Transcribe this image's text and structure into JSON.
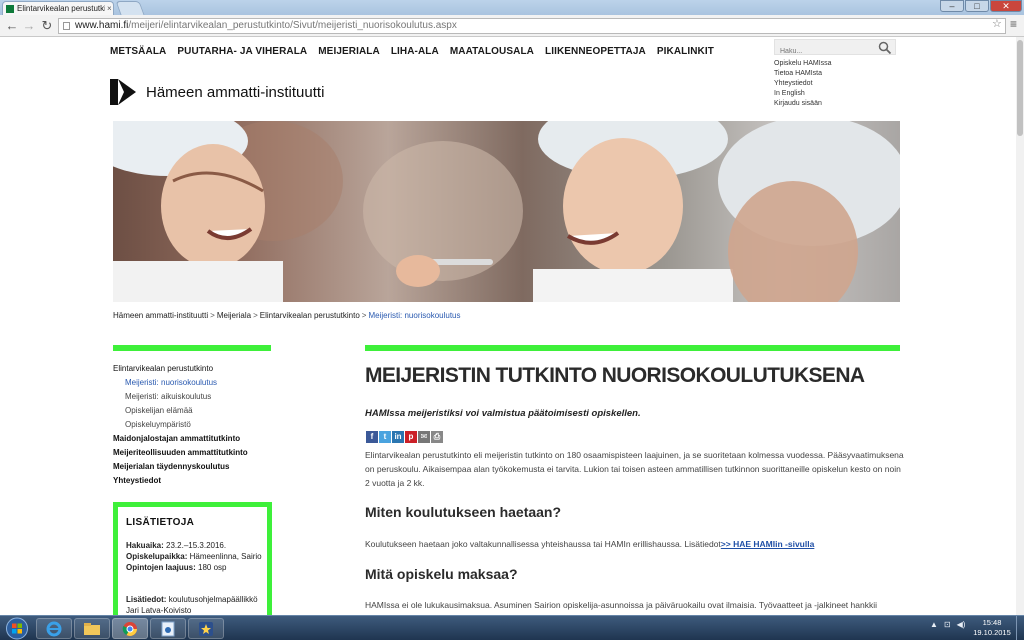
{
  "browser": {
    "tab_title": "Elintarvikealan perustutkinto",
    "tab_close": "×",
    "url_host": "www.hami.fi",
    "url_path": "/meijeri/elintarvikealan_perustutkinto/Sivut/meijeristi_nuorisokoulutus.aspx",
    "window_controls": {
      "minimize": "‒",
      "maximize": "□",
      "close": "✕"
    }
  },
  "site": {
    "topnav": [
      "METSÄALA",
      "PUUTARHA- JA VIHERALA",
      "MEIJERIALA",
      "LIHA-ALA",
      "MAATALOUSALA",
      "LIIKENNEOPETTAJA",
      "PIKALINKIT"
    ],
    "search_placeholder": "Haku...",
    "utility_links": [
      "Opiskelu HAMIssa",
      "Tietoa HAMIsta",
      "Yhteystiedot",
      "In English",
      "Kirjaudu sisään"
    ],
    "logo_text": "Hämeen ammatti-instituutti",
    "breadcrumb": {
      "items": [
        "Hämeen ammatti-instituutti",
        "Meijeriala",
        "Elintarvikealan perustutkinto"
      ],
      "current": "Meijeristi: nuorisokoulutus",
      "separator": ">"
    }
  },
  "sidebar": {
    "items": [
      {
        "label": "Elintarvikealan perustutkinto",
        "level": 0
      },
      {
        "label": "Meijeristi: nuorisokoulutus",
        "level": 2,
        "active": true
      },
      {
        "label": "Meijeristi: aikuiskoulutus",
        "level": 2
      },
      {
        "label": "Opiskelijan elämää",
        "level": 2
      },
      {
        "label": "Opiskeluympäristö",
        "level": 2
      },
      {
        "label": "Maidonjalostajan ammattitutkinto",
        "level": 1
      },
      {
        "label": "Meijeriteollisuuden ammattitutkinto",
        "level": 1
      },
      {
        "label": "Meijerialan täydennyskoulutus",
        "level": 1
      },
      {
        "label": "Yhteystiedot",
        "level": 1
      }
    ],
    "info_box": {
      "title": "LISÄTIETOJA",
      "lines": [
        {
          "label": "Hakuaika:",
          "value": "23.2.–15.3.2016."
        },
        {
          "label": "Opiskelupaikka:",
          "value": "Hämeenlinna, Sairio"
        },
        {
          "label": "Opintojen laajuus:",
          "value": "180 osp"
        }
      ],
      "contact_label": "Lisätiedot:",
      "contact_value": "koulutusohjelmapäällikkö",
      "contact_name": "Jari Latva-Koivisto"
    }
  },
  "main": {
    "title": "MEIJERISTIN TUTKINTO NUORISOKOULUTUKSENA",
    "lead": "HAMIssa meijeristiksi voi valmistua päätoimisesti opiskellen.",
    "share": {
      "facebook": "f",
      "twitter": "t",
      "linkedin": "in",
      "pinterest": "p",
      "email": "✉",
      "print": "⎙"
    },
    "p1": "Elintarvikealan perustutkinto eli meijeristin tutkinto on 180 osaamispisteen laajuinen, ja se suoritetaan kolmessa vuodessa. Pääsyvaatimuksena on peruskoulu. Aikaisempaa alan työkokemusta ei tarvita. Lukion tai toisen asteen ammatillisen tutkinnon suorittaneille opiskelun kesto on noin 2 vuotta ja 2 kk.",
    "h2_apply": "Miten koulutukseen haetaan?",
    "p2_text": "Koulutukseen haetaan joko valtakunnallisessa yhteishaussa tai HAMIn erillishaussa. Lisätiedot",
    "p2_link": ">> HAE HAMIin -sivulla",
    "h2_cost": "Mitä opiskelu maksaa?",
    "p3": "HAMIssa ei ole lukukausimaksua. Asuminen Sairion opiskelija-asunnoissa ja päiväruokailu ovat ilmaisia. Työvaatteet ja -jalkineet hankkii"
  },
  "taskbar": {
    "tray": [
      "▲",
      "⊡",
      "◀)"
    ],
    "time": "15:48",
    "date": "19.10.2015"
  },
  "colors": {
    "accent_green": "#3ef03a",
    "link_blue": "#2a5ab0"
  },
  "icons": [
    "search-icon",
    "star-icon",
    "menu-icon",
    "windows-start-icon",
    "ie-icon",
    "explorer-icon",
    "chrome-icon"
  ]
}
